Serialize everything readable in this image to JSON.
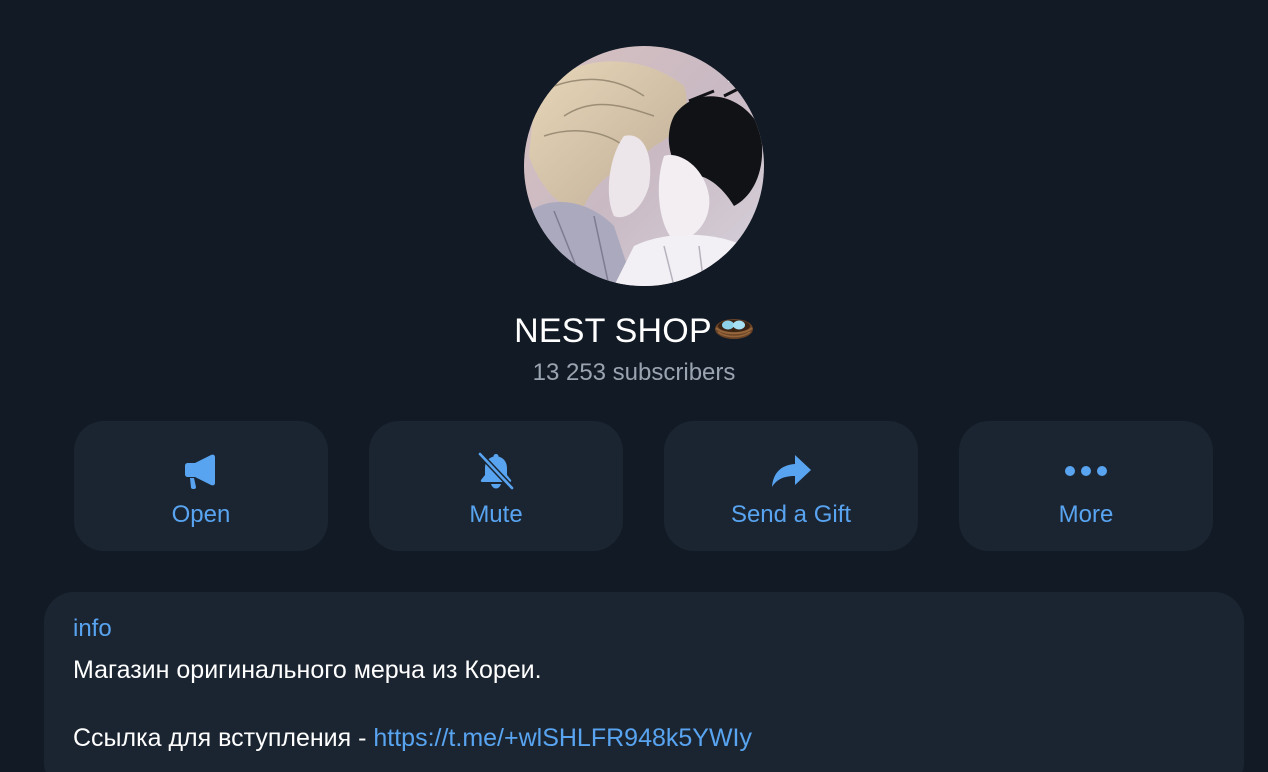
{
  "channel": {
    "name": "NEST SHOP",
    "name_emoji_icon": "nest-with-eggs-icon",
    "subscribers": "13 253 subscribers",
    "avatar_icon": "anime-couple-avatar"
  },
  "actions": [
    {
      "label": "Open",
      "icon": "megaphone-icon"
    },
    {
      "label": "Mute",
      "icon": "bell-slash-icon"
    },
    {
      "label": "Send a Gift",
      "icon": "share-arrow-icon"
    },
    {
      "label": "More",
      "icon": "ellipsis-icon"
    }
  ],
  "info": {
    "label": "info",
    "description": "Магазин оригинального мерча из Кореи.",
    "link_prefix": "Ссылка для вступления - ",
    "link_text": "https://t.me/+wlSHLFR948k5YWIy"
  },
  "colors": {
    "background": "#121a25",
    "card": "#1b2532",
    "accent": "#58a4f0",
    "text": "#ffffff",
    "muted": "#9aa4b1"
  }
}
